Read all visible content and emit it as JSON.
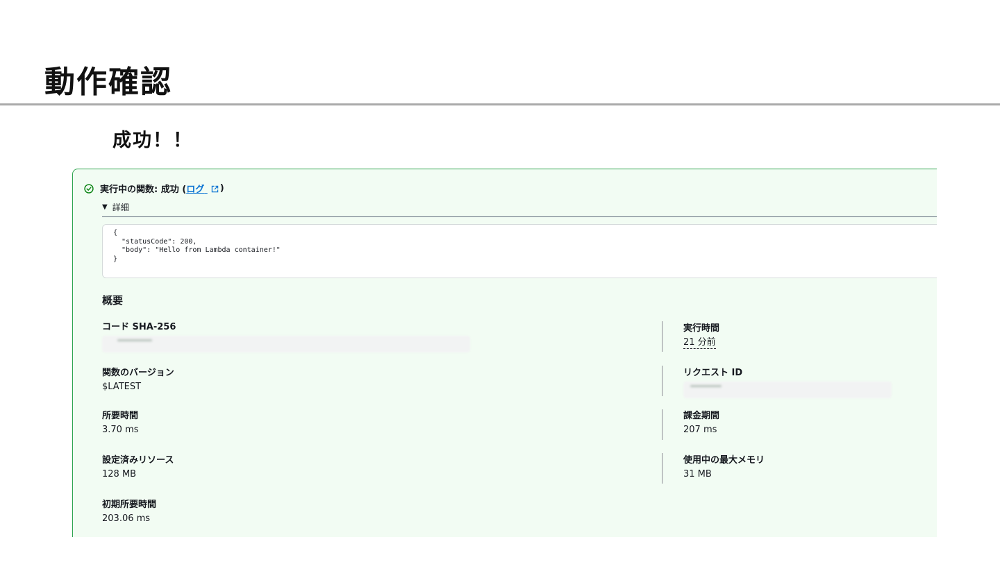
{
  "slide": {
    "title": "動作確認",
    "subtitle": "成功！！"
  },
  "panel": {
    "status_prefix": "実行中の関数: 成功 (",
    "log_link": "ログ",
    "status_suffix": ")",
    "details_label": "詳細",
    "code": "{\n  \"statusCode\": 200,\n  \"body\": \"Hello from Lambda container!\"\n}",
    "summary_heading": "概要",
    "fields": {
      "code_sha256": {
        "label": "コード SHA-256",
        "value": ""
      },
      "execution_time": {
        "label": "実行時間",
        "value": "21 分前"
      },
      "function_version": {
        "label": "関数のバージョン",
        "value": "$LATEST"
      },
      "request_id": {
        "label": "リクエスト ID",
        "value": ""
      },
      "duration": {
        "label": "所要時間",
        "value": "3.70 ms"
      },
      "billed_duration": {
        "label": "課金期間",
        "value": "207 ms"
      },
      "configured_resources": {
        "label": "設定済みリソース",
        "value": "128 MB"
      },
      "max_memory_used": {
        "label": "使用中の最大メモリ",
        "value": "31 MB"
      },
      "init_duration": {
        "label": "初期所要時間",
        "value": "203.06 ms"
      }
    },
    "colors": {
      "success_border": "#2ea44f",
      "panel_background": "#f2fcf3",
      "link": "#0972d3"
    },
    "icons": [
      "success-check-icon",
      "external-link-icon",
      "caret-down-icon"
    ]
  }
}
